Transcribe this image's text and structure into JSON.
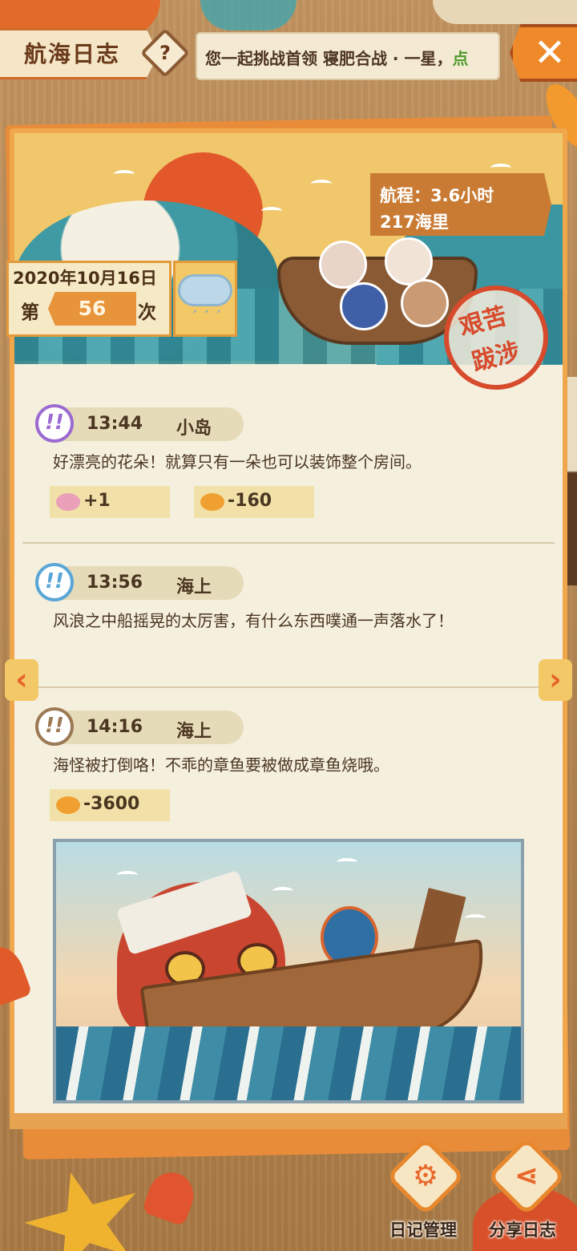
{
  "header": {
    "title": "航海日志",
    "help_glyph": "?",
    "ticker_text": "您一起挑战首领 寝肥合战 · 一星，",
    "ticker_highlight": "点",
    "close_glyph": "✕"
  },
  "voyage": {
    "duration_label": "航程：3.6小时",
    "distance_label": "217海里",
    "stamp_line1": "艰苦",
    "stamp_line2": "跋涉",
    "date": "2020年10月16日",
    "count_prefix": "第",
    "count": "56",
    "count_suffix": "次",
    "weather_icon": "rain-cloud-icon"
  },
  "entries": [
    {
      "time": "13:44",
      "place": "小岛",
      "icon": "exclamation-purple-icon",
      "icon_color": "#9b6bd1",
      "text": "好漂亮的花朵！就算只有一朵也可以装饰整个房间。",
      "rewards": [
        {
          "icon": "flower-icon",
          "value": "+1"
        },
        {
          "icon": "fish-icon",
          "value": "-160"
        }
      ]
    },
    {
      "time": "13:56",
      "place": "海上",
      "icon": "exclamation-blue-icon",
      "icon_color": "#5aa6d6",
      "text": "风浪之中船摇晃的太厉害，有什么东西噗通一声落水了！",
      "rewards": []
    },
    {
      "time": "14:16",
      "place": "海上",
      "icon": "exclamation-brown-icon",
      "icon_color": "#9c7a55",
      "text": "海怪被打倒咯！不乖的章鱼要被做成章鱼烧哦。",
      "rewards": [
        {
          "icon": "fish-icon",
          "value": "-3600"
        }
      ]
    }
  ],
  "nav": {
    "prev_glyph": "‹",
    "next_glyph": "›"
  },
  "buttons": {
    "manage_label": "日记管理",
    "share_label": "分享日志"
  },
  "colors": {
    "accent": "#e8882e",
    "card_bg": "#f5f0de",
    "text": "#4a3521"
  }
}
